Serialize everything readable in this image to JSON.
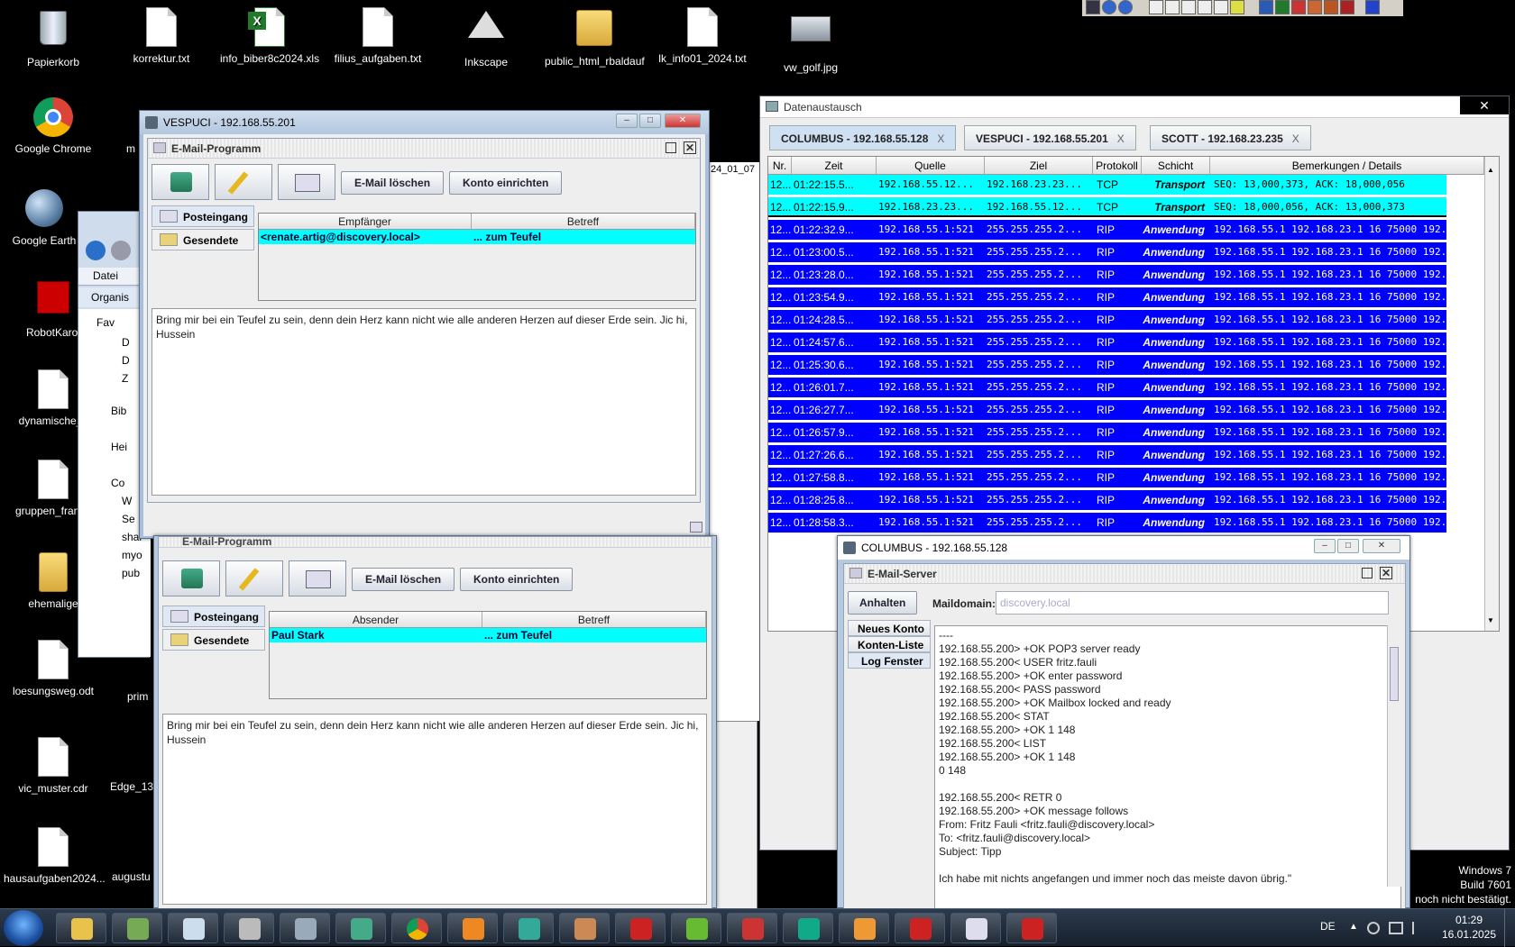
{
  "desktop": {
    "icons_top": [
      {
        "label": "Papierkorb",
        "icon": "recycle-bin-icon"
      },
      {
        "label": "korrektur.txt",
        "icon": "text-file-icon"
      },
      {
        "label": "info_biber8c2024.xls",
        "icon": "excel-file-icon"
      },
      {
        "label": "filius_aufgaben.txt",
        "icon": "text-file-icon"
      },
      {
        "label": "Inkscape",
        "icon": "inkscape-icon"
      },
      {
        "label": "public_html_rbaldauf",
        "icon": "folder-icon"
      },
      {
        "label": "lk_info01_2024.txt",
        "icon": "text-file-icon"
      },
      {
        "label": "vw_golf.jpg",
        "icon": "image-file-icon"
      }
    ],
    "icons_left": [
      {
        "label": "Google Chrome",
        "icon": "chrome-icon"
      },
      {
        "label": "Google Earth",
        "icon": "google-earth-icon"
      },
      {
        "label": "RobotKarol",
        "icon": "robot-karol-icon"
      },
      {
        "label": "dynamische_k",
        "icon": "document-icon"
      },
      {
        "label": "gruppen_franke",
        "icon": "document-icon"
      },
      {
        "label": "ehemalige",
        "icon": "folder-icon"
      },
      {
        "label": "loesungsweg.odt",
        "icon": "odt-file-icon"
      },
      {
        "label": "vic_muster.cdr",
        "icon": "document-icon"
      },
      {
        "label": "hausaufgaben2024...",
        "icon": "document-icon"
      }
    ],
    "icons_partial": [
      "m",
      "prim",
      "Edge_13",
      "augustu"
    ],
    "windows_badge": [
      "Windows 7",
      "Build 7601",
      "noch nicht bestätigt."
    ]
  },
  "explorer_bg": {
    "menu_file": "Datei",
    "menu_organize": "Organis",
    "tree": [
      "Fav",
      "D",
      "D",
      "Z",
      "Bib",
      "Hei",
      "Co",
      "W",
      "Se",
      "shar",
      "myo",
      "pub"
    ],
    "date_fragment": "24_01_07"
  },
  "vespuci_window": {
    "title": "VESPUCI - 192.168.55.201",
    "email_frame_title": "E-Mail-Programm",
    "btn_delete": "E-Mail löschen",
    "btn_account": "Konto einrichten",
    "tab_inbox": "Posteingang",
    "tab_sent": "Gesendete",
    "col_recipient": "Empfänger",
    "col_subject": "Betreff",
    "row_recipient": "<renate.artig@discovery.local>",
    "row_subject": "... zum Teufel",
    "body_text": "Bring mir bei ein Teufel zu sein, denn dein Herz kann nicht wie alle anderen Herzen auf dieser Erde sein. Jic hi, Hussein"
  },
  "second_email": {
    "title": "E-Mail-Programm",
    "btn_delete": "E-Mail löschen",
    "btn_account": "Konto einrichten",
    "tab_inbox": "Posteingang",
    "tab_sent": "Gesendete",
    "col_sender": "Absender",
    "col_subject": "Betreff",
    "row_sender": "Paul Stark",
    "row_subject": "... zum Teufel",
    "body_text": "Bring mir bei ein Teufel zu sein, denn dein Herz kann nicht wie alle anderen Herzen auf dieser Erde sein. Jic hi, Hussein"
  },
  "exchange": {
    "title": "Datenaustausch",
    "tabs": [
      {
        "label": "COLUMBUS - 192.168.55.128",
        "close": "X"
      },
      {
        "label": "VESPUCI - 192.168.55.201",
        "close": "X"
      },
      {
        "label": "SCOTT - 192.168.23.235",
        "close": "X"
      }
    ],
    "headers": [
      "Nr.",
      "Zeit",
      "Quelle",
      "Ziel",
      "Protokoll",
      "Schicht",
      "Bemerkungen / Details"
    ],
    "rows": [
      {
        "nr": "12...",
        "time": "01:22:15.5...",
        "src": "192.168.55.12...",
        "dst": "192.168.23.23...",
        "proto": "TCP",
        "layer": "Transport",
        "details": "SEQ: 13,000,373, ACK: 18,000,056",
        "style": "cyan"
      },
      {
        "nr": "12...",
        "time": "01:22:15.9...",
        "src": "192.168.23.23...",
        "dst": "192.168.55.12...",
        "proto": "TCP",
        "layer": "Transport",
        "details": "SEQ: 18,000,056, ACK: 13,000,373",
        "style": "cyan"
      },
      {
        "nr": "12...",
        "time": "01:22:32.9...",
        "src": "192.168.55.1:521",
        "dst": "255.255.255.2...",
        "proto": "RIP",
        "layer": "Anwendung",
        "details": "192.168.55.1 192.168.23.1 16 75000 192.168.2...",
        "style": "blue"
      },
      {
        "nr": "12...",
        "time": "01:23:00.5...",
        "src": "192.168.55.1:521",
        "dst": "255.255.255.2...",
        "proto": "RIP",
        "layer": "Anwendung",
        "details": "192.168.55.1 192.168.23.1 16 75000 192.168.2...",
        "style": "blue"
      },
      {
        "nr": "12...",
        "time": "01:23:28.0...",
        "src": "192.168.55.1:521",
        "dst": "255.255.255.2...",
        "proto": "RIP",
        "layer": "Anwendung",
        "details": "192.168.55.1 192.168.23.1 16 75000 192.168.2...",
        "style": "blue"
      },
      {
        "nr": "12...",
        "time": "01:23:54.9...",
        "src": "192.168.55.1:521",
        "dst": "255.255.255.2...",
        "proto": "RIP",
        "layer": "Anwendung",
        "details": "192.168.55.1 192.168.23.1 16 75000 192.168.2...",
        "style": "blue"
      },
      {
        "nr": "12...",
        "time": "01:24:28.5...",
        "src": "192.168.55.1:521",
        "dst": "255.255.255.2...",
        "proto": "RIP",
        "layer": "Anwendung",
        "details": "192.168.55.1 192.168.23.1 16 75000 192.168.2...",
        "style": "blue"
      },
      {
        "nr": "12...",
        "time": "01:24:57.6...",
        "src": "192.168.55.1:521",
        "dst": "255.255.255.2...",
        "proto": "RIP",
        "layer": "Anwendung",
        "details": "192.168.55.1 192.168.23.1 16 75000 192.168.2...",
        "style": "blue"
      },
      {
        "nr": "12...",
        "time": "01:25:30.6...",
        "src": "192.168.55.1:521",
        "dst": "255.255.255.2...",
        "proto": "RIP",
        "layer": "Anwendung",
        "details": "192.168.55.1 192.168.23.1 16 75000 192.168.2...",
        "style": "blue"
      },
      {
        "nr": "12...",
        "time": "01:26:01.7...",
        "src": "192.168.55.1:521",
        "dst": "255.255.255.2...",
        "proto": "RIP",
        "layer": "Anwendung",
        "details": "192.168.55.1 192.168.23.1 16 75000 192.168.2...",
        "style": "blue"
      },
      {
        "nr": "12...",
        "time": "01:26:27.7...",
        "src": "192.168.55.1:521",
        "dst": "255.255.255.2...",
        "proto": "RIP",
        "layer": "Anwendung",
        "details": "192.168.55.1 192.168.23.1 16 75000 192.168.2...",
        "style": "blue"
      },
      {
        "nr": "12...",
        "time": "01:26:57.9...",
        "src": "192.168.55.1:521",
        "dst": "255.255.255.2...",
        "proto": "RIP",
        "layer": "Anwendung",
        "details": "192.168.55.1 192.168.23.1 16 75000 192.168.2...",
        "style": "blue"
      },
      {
        "nr": "12...",
        "time": "01:27:26.6...",
        "src": "192.168.55.1:521",
        "dst": "255.255.255.2...",
        "proto": "RIP",
        "layer": "Anwendung",
        "details": "192.168.55.1 192.168.23.1 16 75000 192.168.2...",
        "style": "blue"
      },
      {
        "nr": "12...",
        "time": "01:27:58.8...",
        "src": "192.168.55.1:521",
        "dst": "255.255.255.2...",
        "proto": "RIP",
        "layer": "Anwendung",
        "details": "192.168.55.1 192.168.23.1 16 75000 192.168.2...",
        "style": "blue"
      },
      {
        "nr": "12...",
        "time": "01:28:25.8...",
        "src": "192.168.55.1:521",
        "dst": "255.255.255.2...",
        "proto": "RIP",
        "layer": "Anwendung",
        "details": "192.168.55.1 192.168.23.1 16 75000 192.168.2...",
        "style": "blue"
      },
      {
        "nr": "12...",
        "time": "01:28:58.3...",
        "src": "192.168.55.1:521",
        "dst": "255.255.255.2...",
        "proto": "RIP",
        "layer": "Anwendung",
        "details": "192.168.55.1 192.168.23.1 16 75000 192.168.2...",
        "style": "blue"
      }
    ]
  },
  "columbus_window": {
    "title": "COLUMBUS - 192.168.55.128",
    "server_title": "E-Mail-Server",
    "btn_stop": "Anhalten",
    "maildomain_label": "Maildomain:",
    "maildomain_value": "discovery.local",
    "tabs": [
      "Neues Konto",
      "Konten-Liste",
      "Log Fenster"
    ],
    "log_lines": [
      "----",
      "192.168.55.200> +OK POP3 server ready",
      "192.168.55.200< USER fritz.fauli",
      "192.168.55.200> +OK enter password",
      "192.168.55.200< PASS password",
      "192.168.55.200> +OK Mailbox locked and ready",
      "192.168.55.200< STAT",
      "192.168.55.200> +OK 1 148",
      "192.168.55.200< LIST",
      "192.168.55.200> +OK 1 148",
      "0 148",
      "",
      "192.168.55.200< RETR 0",
      "192.168.55.200> +OK message follows",
      "From: Fritz Fauli <fritz.fauli@discovery.local>",
      "To: <fritz.fauli@discovery.local>",
      "Subject: Tipp",
      "",
      "Ich habe mit nichts angefangen und immer noch das meiste davon übrig.\""
    ]
  },
  "taskbar": {
    "lang": "DE",
    "time": "01:29",
    "date": "16.01.2025",
    "apps": [
      "explorer-icon",
      "filius-icon",
      "notepad-icon",
      "scanner-icon",
      "calculator-icon",
      "network-icon",
      "chrome-icon",
      "media-player-icon",
      "xmind-icon",
      "paint-icon",
      "pl-icon",
      "spreadsheet-icon",
      "robot-icon",
      "arduino-icon",
      "tool-icon",
      "lasso-icon",
      "notes-icon",
      "lasso2-icon"
    ]
  },
  "colors": {
    "cyan": "#00ffff",
    "blue": "#0000ff",
    "accent": "#a9bfd9"
  }
}
